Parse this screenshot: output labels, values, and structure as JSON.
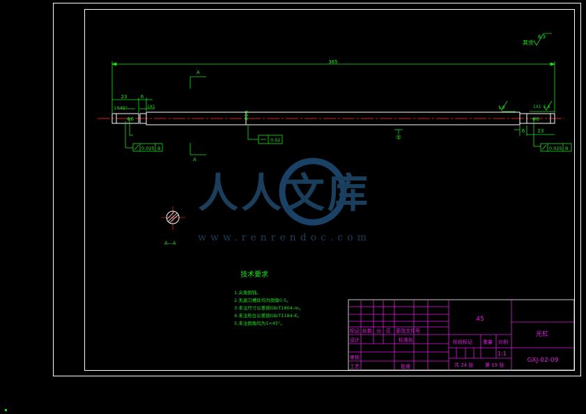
{
  "watermark": {
    "text": "人人文库",
    "url": "www.renrendoc.com"
  },
  "dimensions": {
    "overall_length": "385",
    "left_segment": "23",
    "left_groove": "6",
    "left_chamfer": "1X45°",
    "left_step": "1X1",
    "right_step": "1X1",
    "right_small_dim": "1.6",
    "right_rough": "1.6",
    "right_segment": "23",
    "right_groove": "6",
    "section_mark_top": "A",
    "section_mark_bottom": "A",
    "left_shaft_dia": "Φ6",
    "middle_dia": "Φ10",
    "right_shaft_dia": "Φ6",
    "left_tolerance": "0.025",
    "left_datum": "B",
    "middle_tolerance": "0.02",
    "right_tolerance": "0.025",
    "right_datum": "B",
    "section_label": "A—A",
    "balloon": "⑤"
  },
  "roughness": {
    "rest_label": "其余",
    "value": "6.3"
  },
  "technical_requirements": {
    "title": "技术要求",
    "items": [
      "1.尖角倒钝。",
      "2.无退刀槽处均为倒角0.5。",
      "3.未注尺寸公差按GB/T1804-m。",
      "4.未注形位公差按GB/T1184-K。",
      "5.未注倒角均为1×45°。"
    ]
  },
  "title_block": {
    "material": "45",
    "part_name": "光杠",
    "drawing_no": "GXJ-02-09",
    "row_labels": [
      "标记",
      "处数",
      "分",
      "区",
      "更改文件号"
    ],
    "design": "设计",
    "standardize": "标准化",
    "review": "审核",
    "process": "工艺",
    "approve": "批准",
    "stage_mark": "阶段标记",
    "weight": "重量",
    "scale_label": "比例",
    "scale_value": "1:1",
    "sheets_total": "共 24 张",
    "sheet_no": "第 19 张"
  }
}
